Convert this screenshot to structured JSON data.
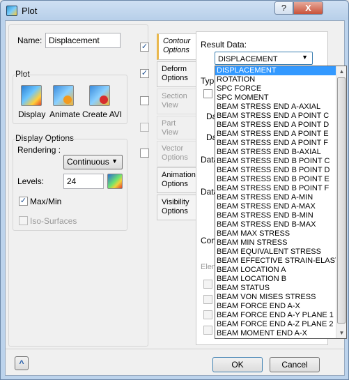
{
  "window": {
    "title": "Plot",
    "help_label": "?",
    "close_label": "X"
  },
  "name": {
    "label": "Name:",
    "value": "Displacement"
  },
  "plot_group": {
    "title": "Plot",
    "display_label": "Display",
    "animate_label": "Animate",
    "create_avi_label": "Create AVI"
  },
  "display_options": {
    "title": "Display Options",
    "rendering_label": "Rendering :",
    "rendering_value": "Continuous",
    "levels_label": "Levels:",
    "levels_value": "24",
    "maxmin_label": "Max/Min",
    "isosurfaces_label": "Iso-Surfaces"
  },
  "tabs": [
    {
      "label": "Contour Options"
    },
    {
      "label": "Deform Options"
    },
    {
      "label": "Section View"
    },
    {
      "label": "Part View"
    },
    {
      "label": "Vector Options"
    },
    {
      "label": "Animation Options"
    },
    {
      "label": "Visibility Options"
    }
  ],
  "panel": {
    "result_data_label": "Result Data:",
    "result_data_value": "DISPLACEMENT",
    "partial_labels": [
      "Type",
      "Da",
      "Da",
      "Data",
      "Data",
      "Cont",
      "Elem"
    ]
  },
  "dropdown_items": [
    "DISPLACEMENT",
    "ROTATION",
    "SPC FORCE",
    "SPC MOMENT",
    "BEAM STRESS END A-AXIAL",
    "BEAM STRESS END A POINT C",
    "BEAM STRESS END A POINT D",
    "BEAM STRESS END A POINT E",
    "BEAM STRESS END A POINT F",
    "BEAM STRESS END B-AXIAL",
    "BEAM STRESS END B POINT C",
    "BEAM STRESS END B POINT D",
    "BEAM STRESS END B POINT E",
    "BEAM STRESS END B POINT F",
    "BEAM STRESS END A-MIN",
    "BEAM STRESS END A-MAX",
    "BEAM STRESS END B-MIN",
    "BEAM STRESS END B-MAX",
    "BEAM MAX STRESS",
    "BEAM MIN STRESS",
    "BEAM EQUIVALENT STRESS",
    "BEAM EFFECTIVE STRAIN-ELASTIC",
    "BEAM LOCATION A",
    "BEAM LOCATION B",
    "BEAM STATUS",
    "BEAM VON MISES STRESS",
    "BEAM FORCE END A-X",
    "BEAM FORCE END A-Y PLANE 1",
    "BEAM FORCE END A-Z PLANE 2",
    "BEAM MOMENT END A-X"
  ],
  "footer": {
    "ok_label": "OK",
    "cancel_label": "Cancel",
    "collapse_icon_label": "^"
  }
}
